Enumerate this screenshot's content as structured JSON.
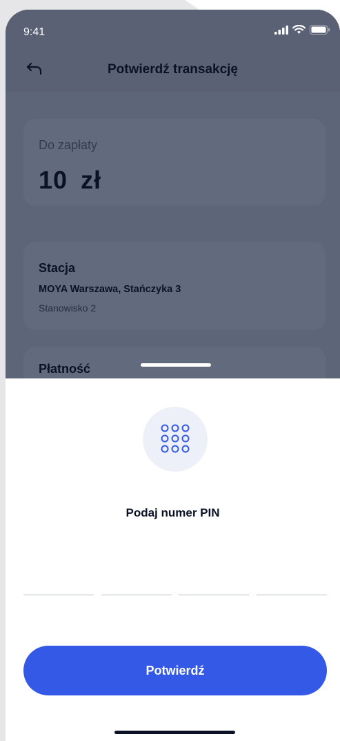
{
  "status_bar": {
    "time": "9:41"
  },
  "header": {
    "title": "Potwierdź transakcję",
    "back_icon": "back-arrow-icon"
  },
  "amount_card": {
    "label": "Do zapłaty",
    "value": "10 zł"
  },
  "station_card": {
    "title": "Stacja",
    "name": "MOYA Warszawa, Stańczyka 3",
    "slot": "Stanowisko 2"
  },
  "payment_card": {
    "title": "Płatność"
  },
  "pin_sheet": {
    "icon": "keypad-icon",
    "prompt": "Podaj numer PIN",
    "fields": [
      "",
      "",
      "",
      ""
    ],
    "confirm_label": "Potwierdź"
  },
  "colors": {
    "accent": "#3459e6",
    "text_dark": "#0c1226",
    "overlay": "#5d6578"
  }
}
